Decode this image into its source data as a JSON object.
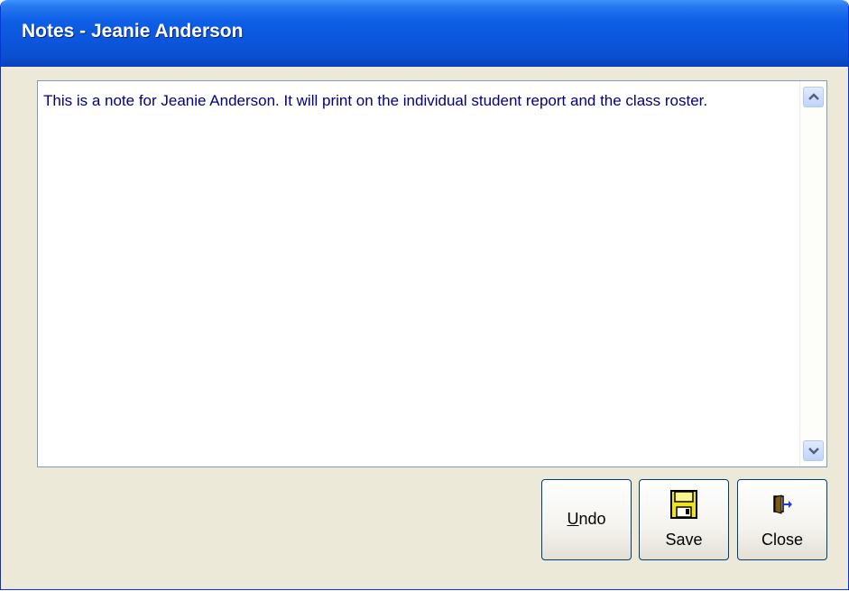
{
  "window": {
    "title": "Notes - Jeanie Anderson"
  },
  "note": {
    "text": "This is a note for Jeanie Anderson.  It will print on the individual student report and the class roster."
  },
  "buttons": {
    "undo_prefix": "U",
    "undo_rest": "ndo",
    "save_label": "Save",
    "close_label": "Close"
  },
  "icons": {
    "scroll_up": "chevron-up-icon",
    "scroll_down": "chevron-down-icon",
    "save": "floppy-disk-icon",
    "close": "door-exit-icon"
  },
  "colors": {
    "titlebar": "#0b56dc",
    "text": "#000080",
    "window_bg": "#ece9d8"
  }
}
